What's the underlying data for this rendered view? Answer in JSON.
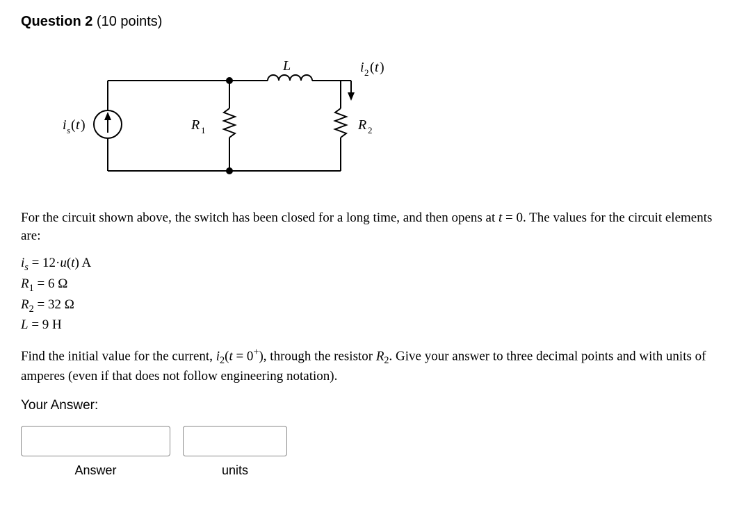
{
  "question": {
    "label_bold": "Question 2",
    "label_points": " (10 points)"
  },
  "circuit": {
    "is_label": "i",
    "is_sub": "s",
    "is_arg": "(t)",
    "R1": "R",
    "R1_sub": "1",
    "L": "L",
    "i2": "i",
    "i2_sub": "2",
    "i2_arg": "(t)",
    "R2": "R",
    "R2_sub": "2"
  },
  "prose1a": "For the circuit shown above, the switch has been closed for a long time, and then opens at ",
  "prose1_t": "t",
  "prose1b": " = 0.   The values for the circuit elements are:",
  "params": {
    "line1_a": "i",
    "line1_sub": "s",
    "line1_b": " = 12·",
    "line1_u": "u",
    "line1_c": "(",
    "line1_t": "t",
    "line1_d": ") A",
    "line2_a": "R",
    "line2_sub": "1",
    "line2_b": " = 6 Ω",
    "line3_a": "R",
    "line3_sub": "2",
    "line3_b": " = 32 Ω",
    "line4_a": "L",
    "line4_b": " = 9 H"
  },
  "prose2a": "Find the initial value for the current, ",
  "prose2_i": "i",
  "prose2_isub": "2",
  "prose2b": "(",
  "prose2_t": "t",
  "prose2c": " = 0",
  "prose2_sup": "+",
  "prose2d": "), through the resistor ",
  "prose2_R": "R",
  "prose2_Rsub": "2",
  "prose2e": ".  Give your answer to three decimal points and with units of amperes (even if that does not follow engineering notation).",
  "your_answer_label": "Your Answer:",
  "answer_label": "Answer",
  "units_label": "units",
  "answer_value": "",
  "units_value": ""
}
